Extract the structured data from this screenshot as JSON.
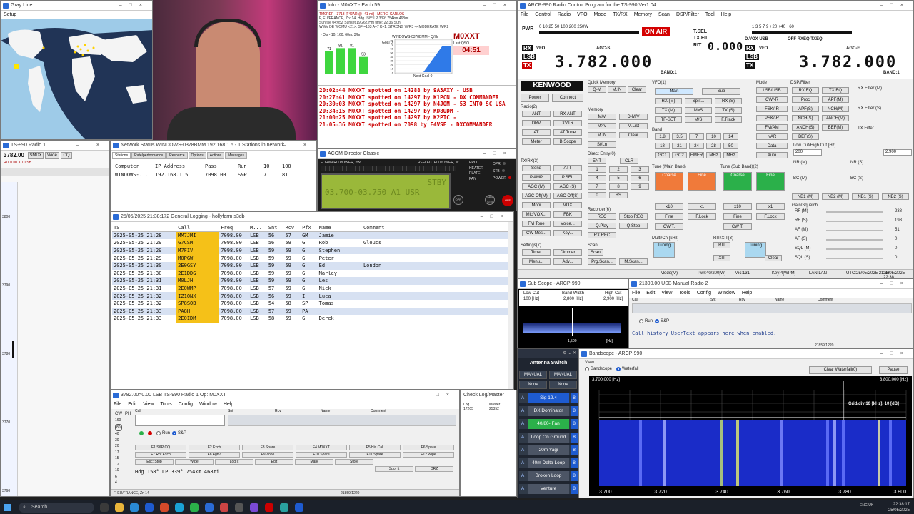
{
  "grayline": {
    "title": "Gray Line",
    "menu": "Setup"
  },
  "ts990": {
    "title": "TS-990 Radio 1",
    "freq": "3782.00",
    "btn1": "SMDX",
    "btn2": "Wide",
    "btn3": "CQ",
    "sub": "RIT  0.00  XIT  LSB",
    "scale": [
      "3800",
      "3790",
      "3780",
      "3770",
      "3760"
    ]
  },
  "info": {
    "title": "Info - M0XXT - Each 59",
    "header1": "TM0REF - 3713 [F4JAR @ -41 mi] - MERCI CARLOS",
    "header2": "F, EU/FRANCE, Zn: 14, Hdg 158° LP 339° 754km 468mi",
    "header3": "Sunrise 04:05Z Sunset 19:26Z Hm time: 22:36(Sun)",
    "header4": "WWV DE WOMU <21>: SFI=133 A=7 K=1: STRONG W/R3 -> MODERATE W/R2",
    "gauge_label": "- Q's - 10, 160, 60m, 3/hr",
    "bars": [
      71,
      81,
      81,
      53
    ],
    "bar_labels": [
      "71",
      "81",
      "81",
      "53"
    ],
    "chart_title": "WINDOWS-0378BMM - Q/Hr",
    "goal_label": "Goal 0",
    "chart_y": [
      "80",
      "70",
      "60",
      "50",
      "40",
      "30",
      "20",
      "10",
      "0"
    ],
    "next_goal": "Next Goal 0",
    "callsign": "M0XXT",
    "last_qso": "Last QSO",
    "clock": "04:51",
    "spots": [
      "20:02:44 M0XXT spotted on 14288 by 9A3AXY - USB",
      "20:27:41 M0XXT spotted on 14297 by K1PCN - DX COMMANDER",
      "20:30:03 M0XXT spotted on 14297 by N4JOM - 53 INTO SC USA",
      "20:34:15 M0XXT spotted on 14297 by KD8UDM -",
      "21:00:25 M0XXT spotted on 14297 by K2PTC -",
      "21:05:36 M0XXT spotted on 7098 by F4VSE - DXCOMMANDER"
    ]
  },
  "network": {
    "title": "Network Status WINDOWS-0378BMM 192.168.1.5 - 1 Stations in network",
    "tabs": [
      "Stations",
      "Rate/performance",
      "Resource",
      "Options",
      "Actions",
      "Messages"
    ],
    "headers": [
      "Computer",
      "IP Address",
      "Pass",
      "Run",
      "10",
      "100"
    ],
    "row": [
      "WINDOWS-...",
      "192.168.1.5",
      "7098.00",
      "S&P",
      "71",
      "81"
    ]
  },
  "acom": {
    "title": "ACOM Director Classic",
    "fwd": "FORWARD POWER, kW",
    "refl": "REFLECTED POWER, W",
    "display": "03.700-03.750 A1 USR",
    "status": "STBY",
    "leds": [
      "PROT",
      "HEATER",
      "PLATE",
      "FAN"
    ],
    "leds2": [
      "OPR",
      "STB",
      "POWER"
    ],
    "b1": "OPR",
    "b2": "OPR STB",
    "b3": "OFF"
  },
  "logging": {
    "title": "25/05/2025 21:38:172 General Logging - hollyfarm.s3db",
    "headers": [
      "TS",
      "Call",
      "Freq",
      "M...",
      "Snt",
      "Rcv",
      "Pfx",
      "Name",
      "Comment"
    ],
    "rows": [
      [
        "2025-05-25 21:28",
        "MM7JMI",
        "7098.00",
        "LSB",
        "56",
        "57",
        "GM",
        "Jamie",
        ""
      ],
      [
        "2025-05-25 21:29",
        "G7CSM",
        "7098.00",
        "LSB",
        "56",
        "59",
        "G",
        "Rob",
        "Gloucs"
      ],
      [
        "2025-05-25 21:29",
        "M7FIV",
        "7098.00",
        "LSB",
        "59",
        "59",
        "G",
        "Stephen",
        ""
      ],
      [
        "2025-05-25 21:29",
        "M0PGW",
        "7098.00",
        "LSB",
        "59",
        "59",
        "G",
        "Peter",
        ""
      ],
      [
        "2025-05-25 21:30",
        "2E0GSY",
        "7098.00",
        "LSB",
        "59",
        "59",
        "G",
        "Ed",
        "London"
      ],
      [
        "2025-05-25 21:30",
        "2E1DDG",
        "7098.00",
        "LSB",
        "59",
        "59",
        "G",
        "Marley",
        ""
      ],
      [
        "2025-05-25 21:31",
        "M0LJH",
        "7098.00",
        "LSB",
        "59",
        "59",
        "G",
        "Les",
        ""
      ],
      [
        "2025-05-25 21:31",
        "2E0WMP",
        "7098.00",
        "LSB",
        "57",
        "59",
        "G",
        "Nick",
        ""
      ],
      [
        "2025-05-25 21:32",
        "IZ1QNX",
        "7098.00",
        "LSB",
        "56",
        "59",
        "I",
        "Luca",
        ""
      ],
      [
        "2025-05-25 21:32",
        "SP8SOB",
        "7098.00",
        "LSB",
        "54",
        "58",
        "SP",
        "Tomas",
        ""
      ],
      [
        "2025-05-25 21:33",
        "PA8H",
        "7098.00",
        "LSB",
        "57",
        "59",
        "PA",
        "",
        ""
      ],
      [
        "2025-05-25 21:33",
        "2E0IDM",
        "7098.00",
        "LSB",
        "58",
        "59",
        "G",
        "Derek",
        ""
      ]
    ]
  },
  "entry": {
    "title": "3782.00>0.00 LSB TS-990 Radio 1   Op: M0XXT",
    "menu": [
      "File",
      "Edit",
      "View",
      "Tools",
      "Config",
      "Window",
      "Help"
    ],
    "cols": [
      "Call",
      "Snt",
      "Rcv",
      "Name",
      "Comment"
    ],
    "bands": [
      "160",
      "80",
      "40",
      "30",
      "20",
      "17",
      "15",
      "12",
      "10",
      "6",
      "4"
    ],
    "mode_cw": "CW",
    "mode_ph": "PH",
    "run": "Run",
    "sp": "S&P",
    "fkeys": [
      "F1 S&P CQ",
      "F2 Exch",
      "F3 Spare",
      "F4 M0XXT",
      "F5 His Call",
      "F6 Spare",
      "F7 Rpt Exch",
      "F8 Agn?",
      "F9 Zone",
      "F10 Spare",
      "F11 Spare",
      "F12 Wipe",
      "Esc: Stop",
      "Wipe",
      "Log It",
      "Edit",
      "Mark",
      "Store",
      "Spot It",
      "QRZ"
    ],
    "hdg": "Hdg 158° LP 339° 754km 468mi",
    "status": "F, EU/FRANCE, Zn 14",
    "footer": "21859/1220"
  },
  "check": {
    "title": "Check Log/Master",
    "c1": "Log",
    "c2": "Master",
    "v1": "17205",
    "v2": "25352"
  },
  "arcp": {
    "title": "ARCP-990 Radio Control Program for the TS-990 Ver1.04",
    "menu": [
      "File",
      "Control",
      "Radio",
      "VFO",
      "Mode",
      "TX/RX",
      "Memory",
      "Scan",
      "DSP/Filter",
      "Tool",
      "Help"
    ],
    "meter_scale": "1  3  5  7  9 +20 +40 +60",
    "pwr_scale": "0  10  25  50  100  200 250W",
    "onair": "ON AIR",
    "freq_main": "3.782.000",
    "freq_sub": "3.782.000",
    "rit_label": "RIT",
    "rit_val": "0.000",
    "mode_main": "LSB",
    "mode_sub": "LSB",
    "agc_main": "AGC-S",
    "agc_sub": "AGC-F",
    "band_main": "BAND:1",
    "band_sub": "BAND:1",
    "tsel": "T.SEL",
    "txfil": "TX.FIL",
    "dvox": "D.VOX",
    "usb": "USB",
    "off": "OFF",
    "rxeq": "RXEQ",
    "txeq": "TXEQ",
    "brand": "KENWOOD",
    "power": "Power",
    "connect": "Connect",
    "sections": [
      "Quick Memory",
      "VFO(1)",
      "Mode",
      "DSP/Filter",
      "Radio(2)",
      "Memory",
      "Band",
      "TX/RX(3)",
      "Tune (Main Band)",
      "Tune (Sub Band)(2)",
      "Recorder(6)",
      "Settings(7)",
      "Scan",
      "RIT/XIT(3)",
      "Multi/Ch [kHz]"
    ],
    "qm": [
      "Q-M",
      "M.IN",
      "Clear"
    ],
    "vfo": [
      "Main",
      "Sub",
      "RX (M)",
      "Split...",
      "RX (S)",
      "TX (M)",
      "M>S",
      "TX (S)",
      "TF-SET",
      "M/S",
      "F.Track"
    ],
    "modes": [
      "LSB/USB",
      "CW/-R",
      "FSK/-R",
      "PSK/-R",
      "FM/AM",
      "NAR",
      "Data",
      "Auto"
    ],
    "dsp": [
      "RX EQ",
      "TX EQ",
      "Proc",
      "APF(M)",
      "APF(S)",
      "NCH(M)",
      "NCH(S)",
      "ANCH(M)",
      "ANCH(S)",
      "BEF(M)",
      "BEF(S)"
    ],
    "radio": [
      "ANT",
      "RX ANT",
      "DRV",
      "XVTR",
      "AT",
      "AT Tune",
      "Meter",
      "B.Scope"
    ],
    "memory": [
      "M/V",
      "D-M/V",
      "M>V",
      "M.List",
      "M.IN",
      "Clear",
      "St/Ln"
    ],
    "bands": [
      "1.8",
      "3.5",
      "7",
      "10",
      "14",
      "18",
      "21",
      "24",
      "28",
      "50",
      "GC1",
      "GC2",
      "EMER",
      "MHz",
      "MHz"
    ],
    "txrx": [
      "Send",
      "ATT",
      "P.AMP",
      "P.SEL",
      "AGC (M)",
      "AGC (S)",
      "AGC Off(M)",
      "AGC Off(S)",
      "Moni",
      "VOX",
      "Mic/VOX...",
      "FBK",
      "FM Tone",
      "Voice...",
      "CW Mes...",
      "Key..."
    ],
    "rec": [
      "REC",
      "Stop REC",
      "Q.Play",
      "Q.Stop",
      "RX REC"
    ],
    "settings": [
      "Timer",
      "Dimmer",
      "Menu...",
      "Adv..."
    ],
    "scan": [
      "Scan",
      "Prg.Scan...",
      "M.Scan..."
    ],
    "tune": [
      "Coarse",
      "Fine",
      "Coarse",
      "Fine",
      "x10",
      "x1",
      "x10",
      "x1",
      "Fine",
      "F.Lock",
      "Fine",
      "F.Lock",
      "CW T.",
      "CW T."
    ],
    "multi": [
      "Tuning",
      "RIT",
      "XIT",
      "Tuning",
      "Clear"
    ],
    "direct": "Direct Entry(0)",
    "keypad": [
      "ENT",
      "CLR",
      "1",
      "2",
      "3",
      "4",
      "5",
      "6",
      "7",
      "8",
      "9",
      "0",
      "BS"
    ],
    "filt": [
      "RX Filter (M)",
      "RX Filter (S)",
      "TX Filter"
    ],
    "lowcut": "Low Cut/High Cut [Hz]",
    "lc_val": "200",
    "hc_val": "2,900",
    "nr_m": "NR (M)",
    "nr_s": "NR (S)",
    "bc_m": "BC (M)",
    "bc_s": "BC (S)",
    "nbs": [
      "NB1 (M)",
      "NB2 (M)",
      "NB1 (S)",
      "NB2 (S)"
    ],
    "gain": "Gain/Squelch",
    "sliders": [
      [
        "RF (M)",
        "238"
      ],
      [
        "RF (S)",
        "198"
      ],
      [
        "AF (M)",
        "51"
      ],
      [
        "AF (S)",
        "0"
      ],
      [
        "SQL (M)",
        "0"
      ],
      [
        "SQL (S)",
        "0"
      ]
    ],
    "status": [
      "Mode(M)",
      "Pwr:40/200[W]",
      "Mic:131",
      "Key:4[WPM]",
      "LAN LAN",
      "UTC:25/05/2025 21:38",
      "25/05/2025 22:38"
    ]
  },
  "subscope": {
    "title": "Sub Scope - ARCP-990",
    "lowcut": "Low Cut",
    "lc": "100 [Hz]",
    "bw": "Band Width",
    "bwv": "2,800 [Hz]",
    "hicut": "High Cut",
    "hc": "2,900 [Hz]",
    "mid": "1,500",
    "unit": "[Hz]"
  },
  "manual": {
    "title": "21300.00 USB Manual Radio 2",
    "menu": [
      "File",
      "Edit",
      "View",
      "Tools",
      "Config",
      "Window",
      "Help"
    ],
    "cols": [
      "Call",
      "Snt",
      "Rcv",
      "Name",
      "Comment"
    ],
    "run": "Run",
    "sp": "S&P",
    "msg": "Call history UserText appears here when enabled.",
    "footer": "21859/1220"
  },
  "antenna": {
    "title": "Antenna Switch",
    "manual1": "MANUAL",
    "manual2": "MANUAL",
    "none1": "None",
    "none2": "None",
    "rows": [
      [
        "Sig 12.4",
        "8"
      ],
      [
        "DX Dominator",
        "8"
      ],
      [
        "40/80- Fan",
        "8"
      ],
      [
        "Loop On Ground",
        "8"
      ],
      [
        "20m Yagi",
        "8"
      ],
      [
        "40m Delta Loop",
        "8"
      ],
      [
        "Broken Loop",
        "8"
      ],
      [
        "Venture",
        "8"
      ]
    ]
  },
  "bandscope": {
    "title": "Bandscope - ARCP-990",
    "view": "View",
    "opt1": "Bandscope",
    "opt2": "Waterfall",
    "clear": "Clear Waterfall(0)",
    "pause": "Pause",
    "left": "3.700.000 [Hz]",
    "right": "3.800.000 [Hz]",
    "grid": "Grid/div 10 [kHz], 10 [dB]",
    "axis": [
      "3.700",
      "3.720",
      "3.740",
      "3.760",
      "3.780",
      "3.800"
    ]
  },
  "taskbar": {
    "search": "Search",
    "lang": "ENG UK",
    "time": "22:38:17",
    "date": "25/05/2025"
  },
  "colors": {
    "accent": "#1e5bd0",
    "onair": "#d40000",
    "gold": "#f5c118",
    "green": "#2bb04a",
    "orange": "#f07a3a"
  }
}
